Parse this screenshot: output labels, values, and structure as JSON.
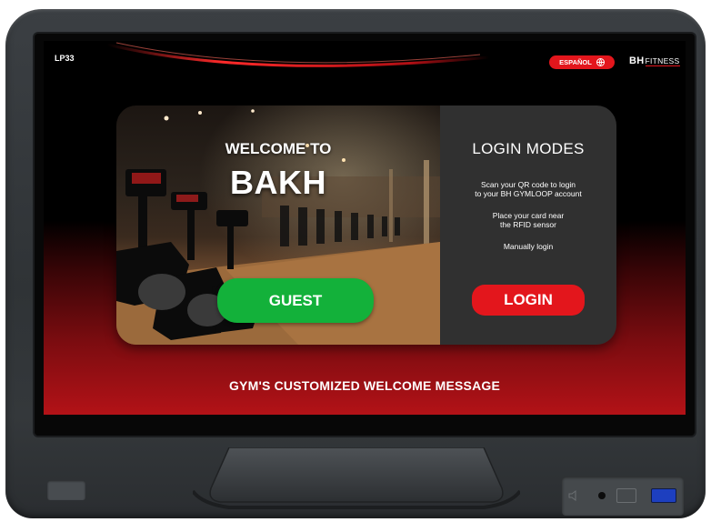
{
  "header": {
    "device_id": "LP33",
    "language_button": "ESPAÑOL",
    "brand_bh": "BH",
    "brand_fitness": "FITNESS"
  },
  "welcome": {
    "line1": "WELCOME TO",
    "gym_name": "BAKH",
    "guest_button": "GUEST"
  },
  "login": {
    "title": "LOGIN MODES",
    "qr_line1": "Scan your QR code to login",
    "qr_line2": "to your BH GYMLOOP account",
    "rfid_line1": "Place your card near",
    "rfid_line2": "the RFID sensor",
    "manual": "Manually login",
    "login_button": "LOGIN"
  },
  "footer": {
    "message": "GYM'S CUSTOMIZED WELCOME MESSAGE"
  },
  "colors": {
    "accent_red": "#e3161c",
    "guest_green": "#13b13a",
    "login_panel": "#303030",
    "usb_blue": "#1d3fbf"
  },
  "icons": {
    "language": "globe-icon",
    "speaker": "speaker-icon",
    "usb": "usb-icon"
  }
}
